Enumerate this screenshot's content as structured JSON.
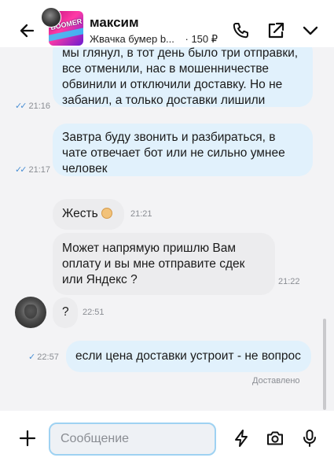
{
  "header": {
    "name": "максим",
    "product_title": "Жвачка бумер b...",
    "price": "· 150 ₽",
    "product_logo_text": "BOOMER"
  },
  "messages": [
    {
      "direction": "out",
      "text_lines": [
        "мы глянул, в тот день было три отправки,",
        "все отменили, нас в мошенничестве",
        "обвинили и отключили доставку. Но не",
        "забанил, а только доставки лишили"
      ],
      "time": "21:16",
      "read": true
    },
    {
      "direction": "out",
      "text_lines": [
        "Завтра буду звонить и разбираться, в",
        "чате отвечает бот или не сильно умнее",
        "человек"
      ],
      "time": "21:17",
      "read": true
    },
    {
      "direction": "in",
      "text_lines": [
        "Жесть"
      ],
      "time": "21:21",
      "emoji": "smiling-face"
    },
    {
      "direction": "in",
      "text_lines": [
        "Может напрямую пришлю Вам",
        "оплату и вы мне отправите сдек",
        "или Яндекс ?"
      ],
      "time": "21:22"
    },
    {
      "direction": "in",
      "text_lines": [
        "?"
      ],
      "time": "22:51"
    },
    {
      "direction": "out",
      "text_lines": [
        "если цена доставки устроит - не вопрос"
      ],
      "time": "22:57",
      "read": false
    }
  ],
  "status": {
    "delivered": "Доставлено"
  },
  "composer": {
    "placeholder": "Сообщение"
  },
  "colors": {
    "out_bubble": "#e1f1fc",
    "in_bubble": "#ececee",
    "accent": "#4a8fd4",
    "input_border": "#9ed2f2"
  }
}
